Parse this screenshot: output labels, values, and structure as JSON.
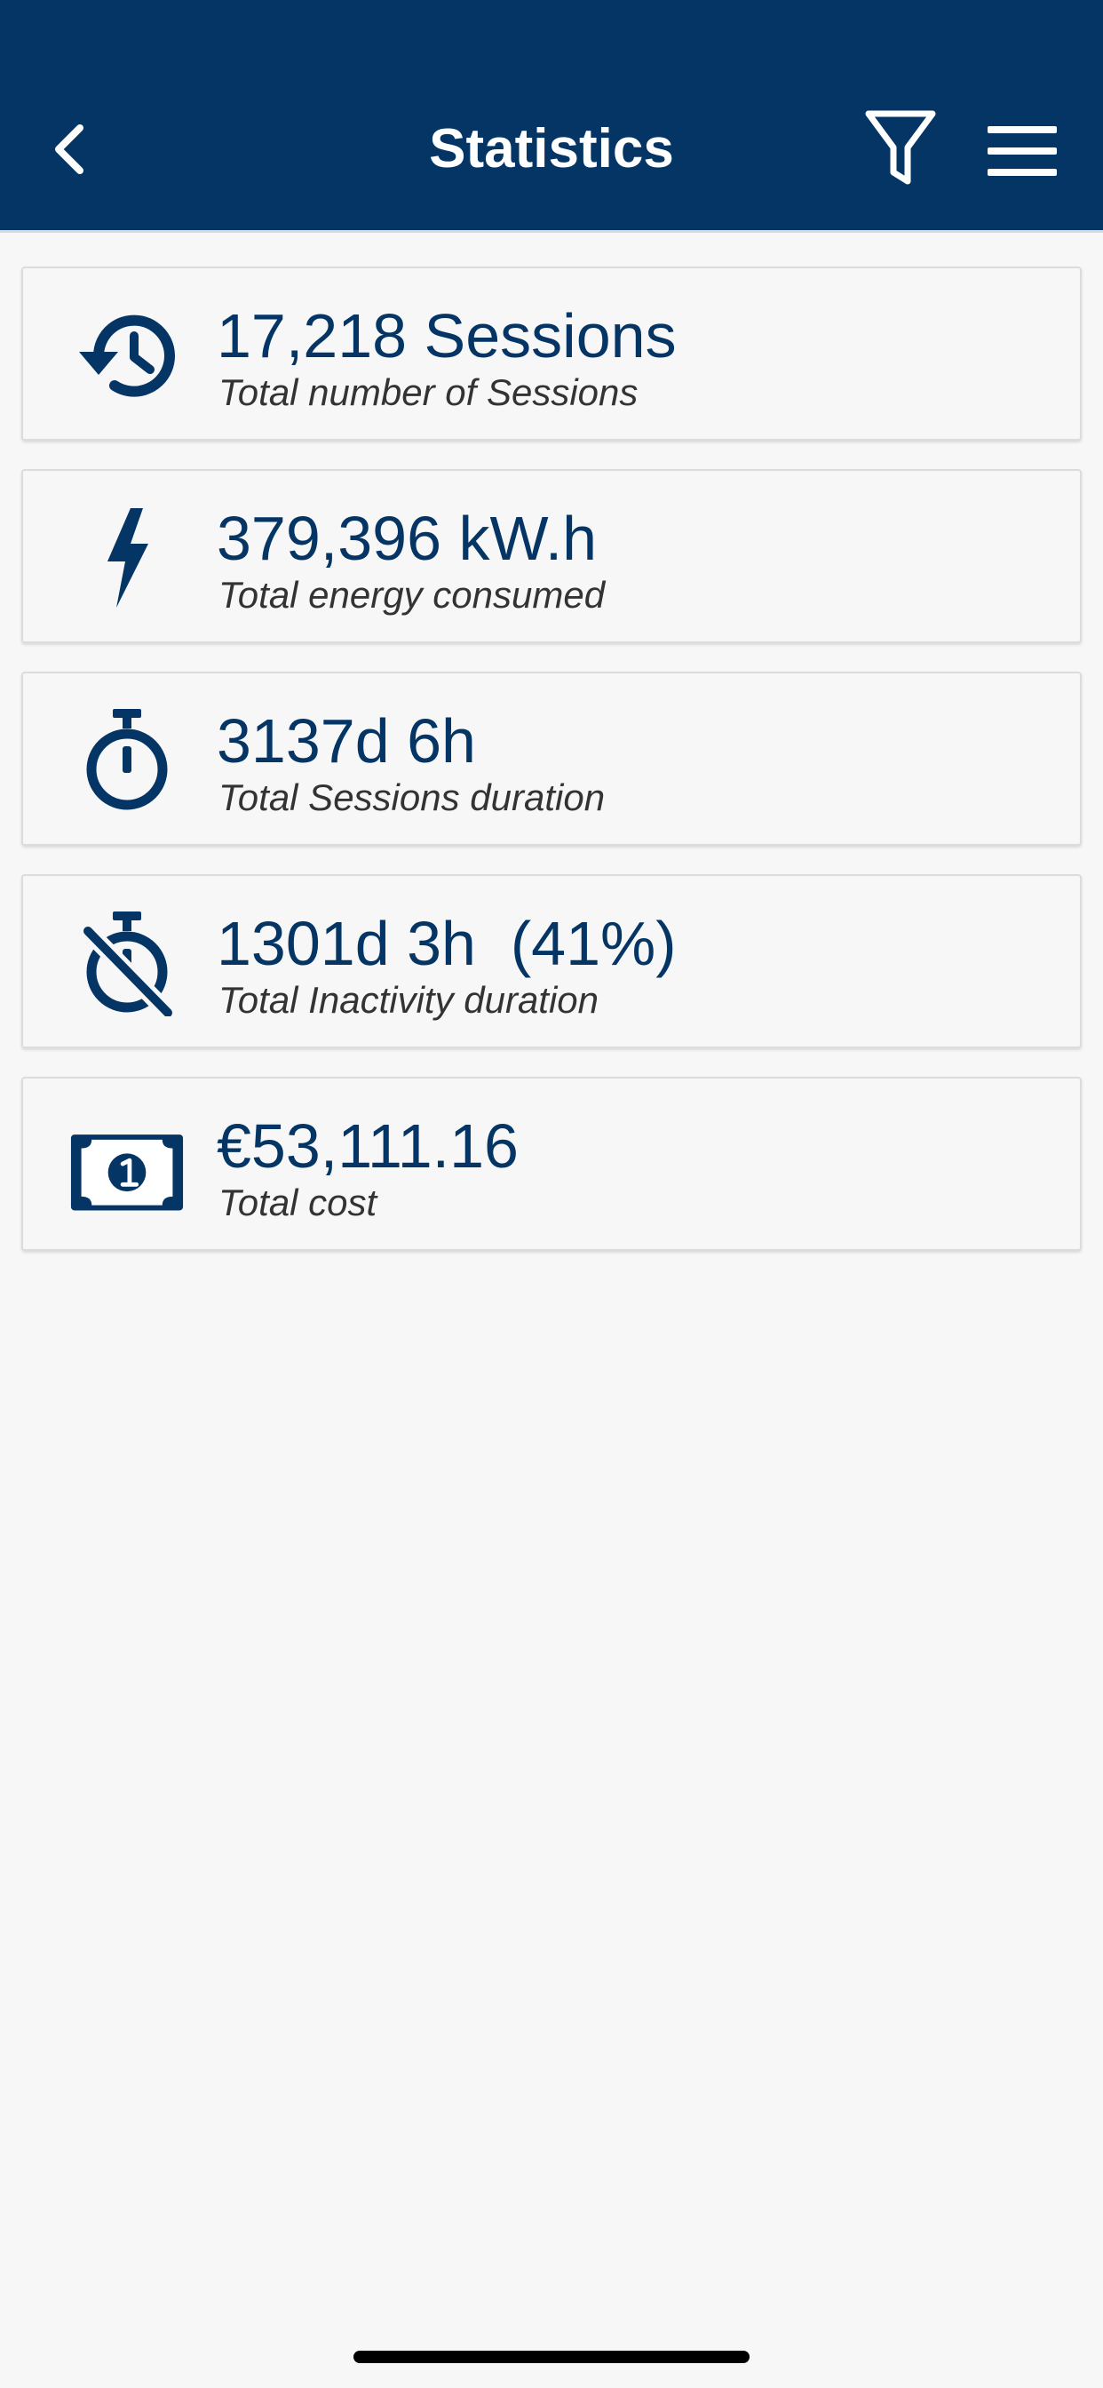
{
  "header": {
    "title": "Statistics",
    "background_color": "#043565",
    "back_icon": "chevron-left-icon",
    "filter_icon": "filter-icon",
    "menu_icon": "hamburger-menu-icon"
  },
  "accent_color": "#043565",
  "stats": [
    {
      "icon": "history-icon",
      "value": "17,218 Sessions",
      "label": "Total number of Sessions"
    },
    {
      "icon": "lightning-bolt-icon",
      "value": "379,396 kW.h",
      "label": "Total energy consumed"
    },
    {
      "icon": "stopwatch-icon",
      "value": "3137d 6h",
      "label": "Total Sessions duration"
    },
    {
      "icon": "stopwatch-off-icon",
      "value": "1301d 3h  (41%)",
      "label": "Total Inactivity duration"
    },
    {
      "icon": "banknote-icon",
      "value": "€53,111.16",
      "label": "Total cost"
    }
  ]
}
